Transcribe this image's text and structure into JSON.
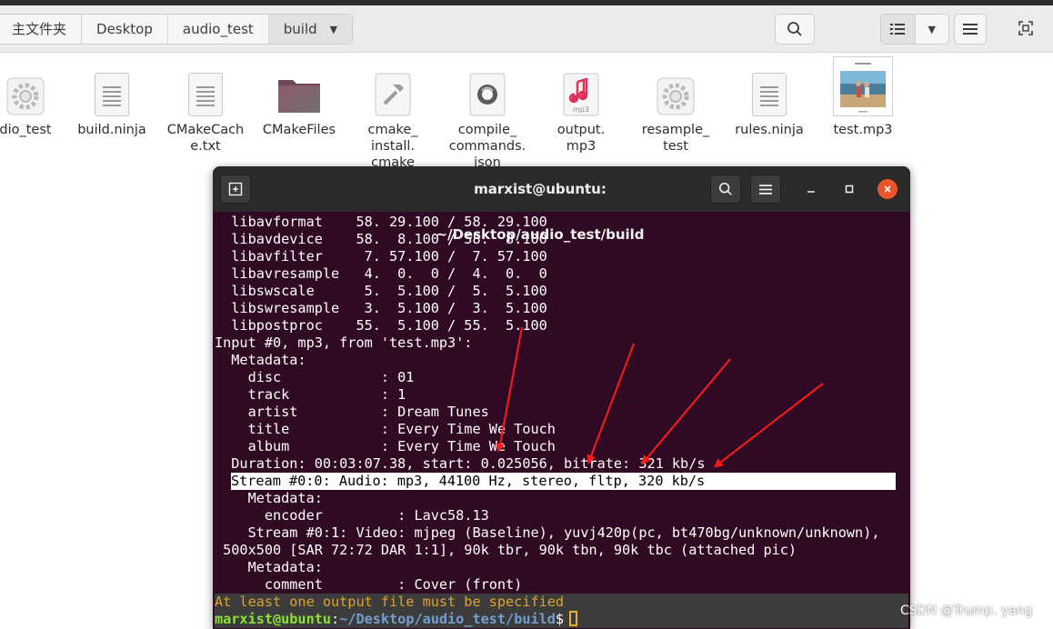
{
  "file_manager": {
    "breadcrumbs": [
      {
        "label": "主文件夹"
      },
      {
        "label": "Desktop"
      },
      {
        "label": "audio_test"
      },
      {
        "label": "build"
      }
    ],
    "files": [
      {
        "name": "dio_test",
        "icon": "executable-gear-icon"
      },
      {
        "name": "build.ninja",
        "icon": "text-document-icon"
      },
      {
        "name": "CMakeCache.txt",
        "icon": "text-document-icon"
      },
      {
        "name": "CMakeFiles",
        "icon": "folder-icon"
      },
      {
        "name": "cmake_install.cmake",
        "icon": "script-hammer-icon"
      },
      {
        "name": "compile_commands.json",
        "icon": "json-document-icon"
      },
      {
        "name": "output.mp3",
        "icon": "mp3-audio-icon"
      },
      {
        "name": "resample_test",
        "icon": "executable-gear-icon"
      },
      {
        "name": "rules.ninja",
        "icon": "text-document-icon"
      },
      {
        "name": "test.mp3",
        "icon": "album-art-thumbnail"
      }
    ],
    "file_labels": [
      [
        "dio_test"
      ],
      [
        "build.ninja"
      ],
      [
        "CMakeCach",
        "e.txt"
      ],
      [
        "CMakeFiles"
      ],
      [
        "cmake_",
        "install.",
        "cmake"
      ],
      [
        "compile_",
        "commands.",
        "json"
      ],
      [
        "output.",
        "mp3"
      ],
      [
        "resample_",
        "test"
      ],
      [
        "rules.ninja"
      ],
      [
        "test.mp3"
      ]
    ],
    "mp3_badge": "mp3"
  },
  "terminal": {
    "title": "marxist@ubuntu: ~/Desktop/audio_test/build",
    "lines": [
      "  libavformat    58. 29.100 / 58. 29.100",
      "  libavdevice    58.  8.100 / 58.  8.100",
      "  libavfilter     7. 57.100 /  7. 57.100",
      "  libavresample   4.  0.  0 /  4.  0.  0",
      "  libswscale      5.  5.100 /  5.  5.100",
      "  libswresample   3.  5.100 /  3.  5.100",
      "  libpostproc    55.  5.100 / 55.  5.100",
      "Input #0, mp3, from 'test.mp3':",
      "  Metadata:",
      "    disc            : 01",
      "    track           : 1",
      "    artist          : Dream Tunes",
      "    title           : Every Time We Touch",
      "    album           : Every Time We Touch",
      "  Duration: 00:03:07.38, start: 0.025056, bitrate: 321 kb/s",
      "Stream #0:0: Audio: mp3, 44100 Hz, stereo, fltp, 320 kb/s",
      "    Metadata:",
      "      encoder         : Lavc58.13",
      "    Stream #0:1: Video: mjpeg (Baseline), yuvj420p(pc, bt470bg/unknown/unknown),",
      " 500x500 [SAR 72:72 DAR 1:1], 90k tbr, 90k tbn, 90k tbc (attached pic)",
      "    Metadata:",
      "      comment         : Cover (front)",
      "At least one output file must be specified"
    ],
    "highlight_line_index": 15,
    "error_line_index": 22,
    "prompt": {
      "user_host": "marxist@ubuntu",
      "separator": ":",
      "path": "~/Desktop/audio_test/build",
      "symbol": "$"
    }
  },
  "watermark": "CSDN @Trump. yang",
  "colors": {
    "terminal_bg": "#300a24",
    "titlebar_bg": "#2b2b2b",
    "close_button": "#e9542b",
    "prompt_user": "#8ae234",
    "prompt_path": "#729fcf",
    "error_text": "#dda22b",
    "annotation_arrows": "#ff1a1a"
  }
}
